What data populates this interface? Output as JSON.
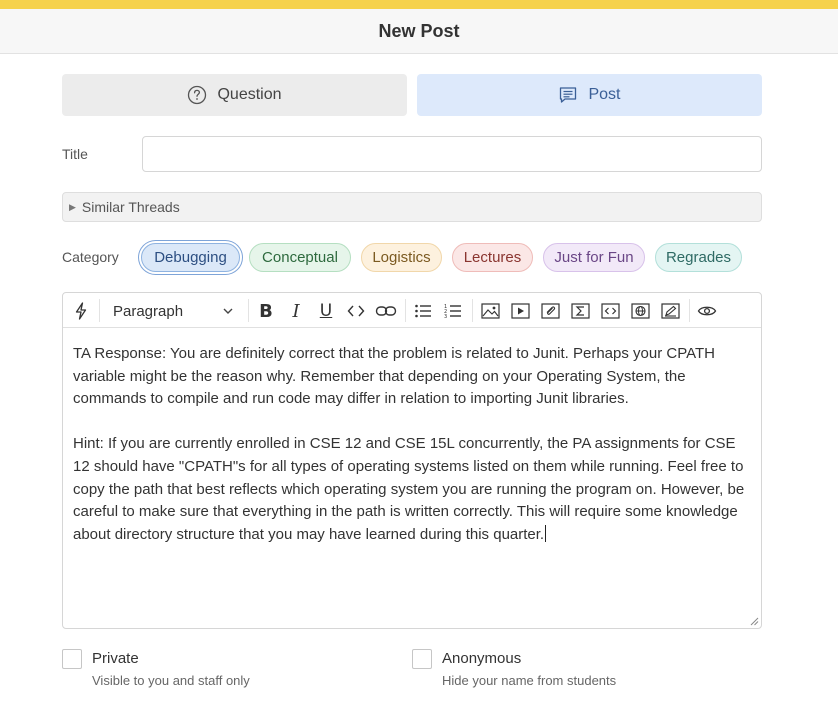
{
  "header": {
    "title": "New Post"
  },
  "post_type": {
    "question_label": "Question",
    "post_label": "Post",
    "selected": "Post"
  },
  "title_field": {
    "label": "Title",
    "value": "",
    "placeholder": ""
  },
  "similar_threads": {
    "label": "Similar Threads"
  },
  "category": {
    "label": "Category",
    "selected": "Debugging",
    "options": [
      "Debugging",
      "Conceptual",
      "Logistics",
      "Lectures",
      "Just for Fun",
      "Regrades"
    ]
  },
  "editor": {
    "block_format": "Paragraph",
    "toolbar_icons": [
      "lightning-icon",
      "bold-icon",
      "italic-icon",
      "underline-icon",
      "code-icon",
      "link-icon",
      "bullet-list-icon",
      "numbered-list-icon",
      "image-icon",
      "video-icon",
      "attachment-icon",
      "math-icon",
      "code-block-icon",
      "web-embed-icon",
      "draw-icon",
      "preview-icon"
    ],
    "paragraphs": [
      "TA Response: You are definitely correct that the problem is related to Junit. Perhaps your CPATH variable might be the reason why. Remember that depending on your Operating System, the commands to compile and run code may differ in relation to importing Junit libraries.",
      "Hint: If you are currently enrolled in CSE 12 and CSE 15L concurrently, the PA assignments for CSE 12 should have \"CPATH\"s for all types of operating systems listed on them while running. Feel free to copy the path that best reflects which operating system you are running the program on. However, be careful to make sure that everything in the path is written correctly. This will require some knowledge about directory structure that you may have learned during this quarter."
    ]
  },
  "options": {
    "private": {
      "label": "Private",
      "description": "Visible to you and staff only",
      "checked": false
    },
    "anonymous": {
      "label": "Anonymous",
      "description": "Hide your name from students",
      "checked": false
    }
  },
  "colors": {
    "top_strip": "#f6d24c",
    "post_selected_bg": "#dde9fb",
    "post_selected_text": "#3a5f97"
  }
}
